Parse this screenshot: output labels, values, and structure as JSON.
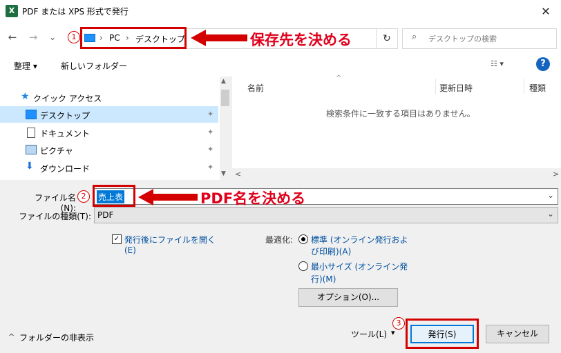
{
  "window": {
    "title": "PDF または XPS 形式で発行",
    "app_icon": "X",
    "close_glyph": "✕"
  },
  "address": {
    "crumbs": [
      "PC",
      "デスクトップ"
    ],
    "sep": "›",
    "refresh_glyph": "↻"
  },
  "search": {
    "placeholder": "デスクトップの検索",
    "icon_glyph": "⌕"
  },
  "nav_glyphs": {
    "back": "←",
    "forward": "→",
    "dropdown": "⌄",
    "up": "↑"
  },
  "toolbar": {
    "organize": "整理 ▾",
    "new_folder": "新しいフォルダー",
    "view": "☷ ▾",
    "help": "?"
  },
  "sidebar": {
    "quick_access": "クイック アクセス",
    "items": [
      {
        "label": "デスクトップ"
      },
      {
        "label": "ドキュメント"
      },
      {
        "label": "ピクチャ"
      },
      {
        "label": "ダウンロード"
      }
    ],
    "pin_glyph": "📌"
  },
  "file_list": {
    "columns": [
      "名前",
      "更新日時",
      "種類"
    ],
    "empty_message": "検索条件に一致する項目はありません。",
    "sort_glyph": "^"
  },
  "form": {
    "filename_label": "ファイル名(N):",
    "filename_value": "売上表",
    "filetype_label": "ファイルの種類(T):",
    "filetype_value": "PDF",
    "dropdown_glyph": "⌄",
    "open_after_label_1": "発行後にファイルを開く",
    "open_after_label_2": "(E)",
    "optimize_label": "最適化:",
    "optimize_standard_1": "標準 (オンライン発行およ",
    "optimize_standard_2": "び印刷)(A)",
    "optimize_min_1": "最小サイズ (オンライン発",
    "optimize_min_2": "行)(M)",
    "options_button": "オプション(O)..."
  },
  "footer": {
    "hide_folders": "フォルダーの非表示",
    "hide_glyph": "^",
    "tools": "ツール(L)",
    "tools_caret": "▾",
    "publish": "発行(S)",
    "cancel": "キャンセル"
  },
  "annotations": {
    "step1_num": "1",
    "step1_text": "保存先を決める",
    "step2_num": "2",
    "step2_text": "PDF名を決める",
    "step3_num": "3"
  },
  "colors": {
    "annotation": "#d40000",
    "selection": "#0078d7",
    "help": "#1565c0"
  }
}
